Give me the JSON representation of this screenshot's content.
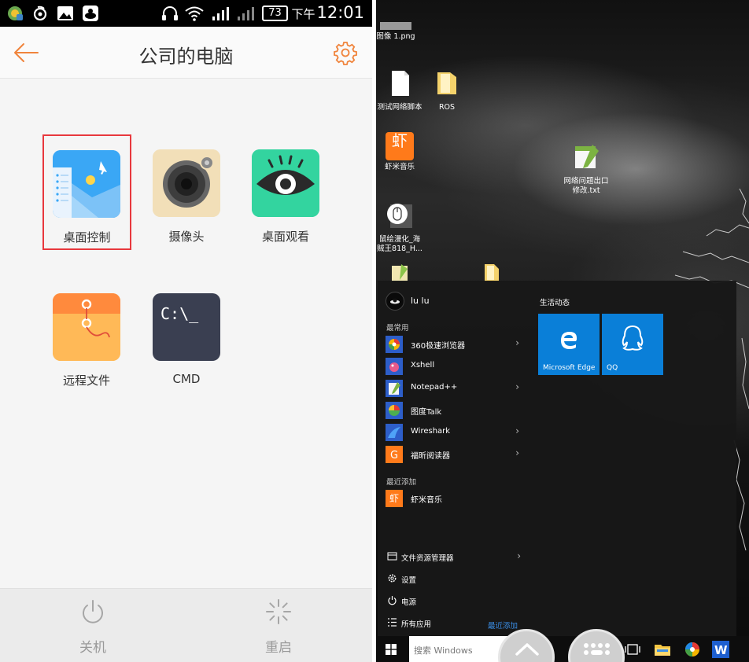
{
  "phone": {
    "status": {
      "battery": "73",
      "ampm": "下午",
      "time": "12:01"
    },
    "header": {
      "title": "公司的电脑"
    },
    "tiles": [
      {
        "label": "桌面控制"
      },
      {
        "label": "摄像头"
      },
      {
        "label": "桌面观看"
      },
      {
        "label": "远程文件"
      },
      {
        "label": "CMD",
        "icon_text": "C:\\_"
      }
    ],
    "bottom": {
      "shutdown_label": "关机",
      "restart_label": "重启"
    },
    "colors": {
      "accent": "#f0843c",
      "highlight_border": "#e8383d"
    }
  },
  "desktop": {
    "icons": [
      {
        "label": "图像 1.png"
      },
      {
        "label": "测试网络脚本"
      },
      {
        "label": "ROS"
      },
      {
        "label": "虾米音乐"
      },
      {
        "label": "网络问题出口\n修改.txt"
      },
      {
        "label": "鼠绘漫化_海\n贼王818_H..."
      }
    ],
    "start_menu": {
      "user": "lu lu",
      "most_used_heading": "最常用",
      "most_used": [
        {
          "label": "360极速浏览器",
          "has_arrow": true
        },
        {
          "label": "Xshell",
          "has_arrow": false
        },
        {
          "label": "Notepad++",
          "has_arrow": true
        },
        {
          "label": "图度Talk",
          "has_arrow": false
        },
        {
          "label": "Wireshark",
          "has_arrow": true
        },
        {
          "label": "福昕阅读器",
          "has_arrow": true
        }
      ],
      "recent_heading": "最近添加",
      "recent": [
        {
          "label": "虾米音乐"
        }
      ],
      "system": [
        {
          "label": "文件资源管理器",
          "has_arrow": true
        },
        {
          "label": "设置"
        },
        {
          "label": "电源"
        },
        {
          "label": "所有应用"
        }
      ],
      "recently_added_link": "最近添加",
      "live_heading": "生活动态",
      "live_tiles": [
        {
          "label": "Microsoft Edge"
        },
        {
          "label": "QQ"
        }
      ]
    },
    "taskbar": {
      "search_placeholder": "搜索 Windows"
    }
  }
}
